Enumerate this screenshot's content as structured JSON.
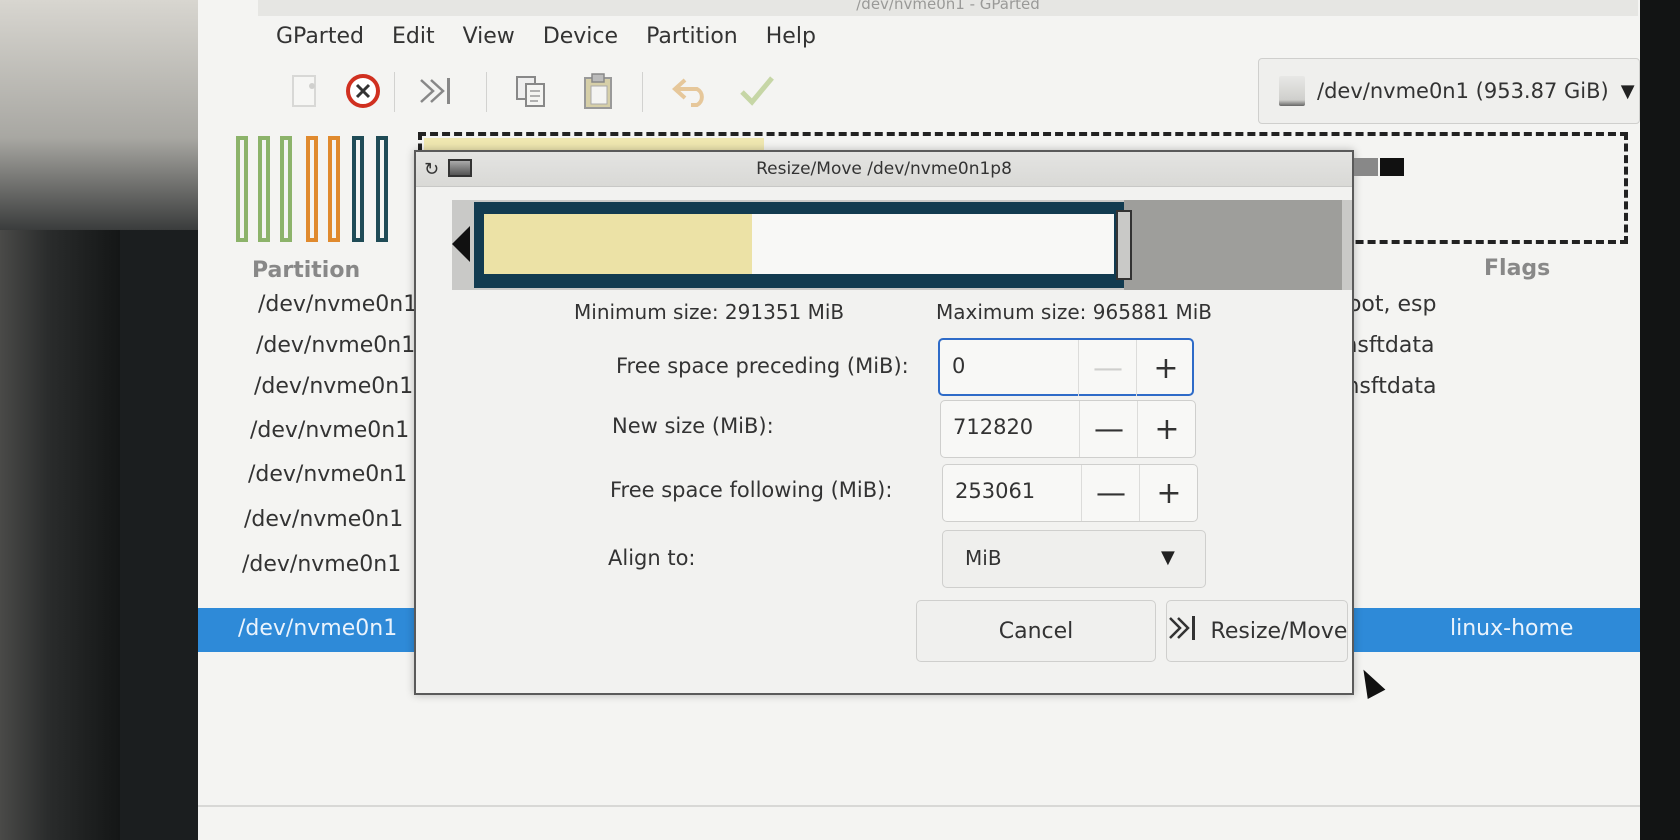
{
  "window": {
    "title_partial": "/dev/nvme0n1 - GParted"
  },
  "menubar": {
    "items": [
      "GParted",
      "Edit",
      "View",
      "Device",
      "Partition",
      "Help"
    ]
  },
  "toolbar": {
    "new_icon": "new-partition-icon",
    "delete_icon": "delete-icon",
    "resize_icon": "resize-move-icon",
    "copy_icon": "copy-icon",
    "paste_icon": "paste-icon",
    "undo_icon": "undo-icon",
    "apply_icon": "apply-icon",
    "device": "/dev/nvme0n1 (953.87 GiB)"
  },
  "colors": {
    "selection": "#2e8ad8",
    "partition_border": "#123b50",
    "used_space": "#ece2a6",
    "stripe_green": "#8cb36a",
    "stripe_orange": "#e08a2e",
    "stripe_teal": "#1f4b56"
  },
  "table": {
    "headers": {
      "partition": "Partition",
      "flags": "Flags"
    },
    "rows": [
      {
        "partition": "/dev/nvme0n1",
        "flags": "boot, esp"
      },
      {
        "partition": "/dev/nvme0n1",
        "flags": "msftdata"
      },
      {
        "partition": "/dev/nvme0n1",
        "flags": "msftdata"
      },
      {
        "partition": "/dev/nvme0n1",
        "flags": ""
      },
      {
        "partition": "/dev/nvme0n1",
        "flags": ""
      },
      {
        "partition": "/dev/nvme0n1",
        "flags": ""
      },
      {
        "partition": "/dev/nvme0n1",
        "flags": ""
      },
      {
        "partition": "/dev/nvme0n1",
        "flags": "linux-home"
      }
    ]
  },
  "dialog": {
    "title": "Resize/Move /dev/nvme0n1p8",
    "min_size": "Minimum size: 291351 MiB",
    "max_size": "Maximum size: 965881 MiB",
    "free_preceding_label": "Free space preceding (MiB):",
    "free_preceding_value": "0",
    "new_size_label": "New size (MiB):",
    "new_size_value": "712820",
    "free_following_label": "Free space following (MiB):",
    "free_following_value": "253061",
    "align_label": "Align to:",
    "align_value": "MiB",
    "cancel": "Cancel",
    "resize_move": "Resize/Move",
    "minus_glyph": "—",
    "plus_glyph": "+"
  }
}
